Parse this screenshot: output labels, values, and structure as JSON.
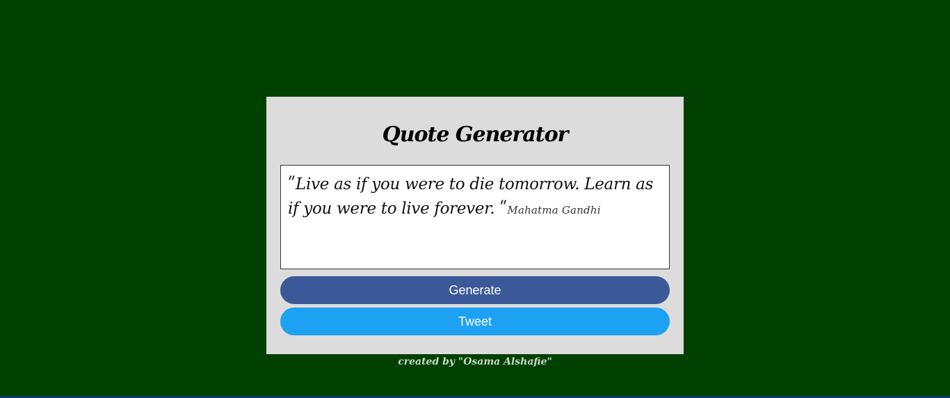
{
  "app": {
    "title": "Quote Generator"
  },
  "quote": {
    "open_mark": "ʺ",
    "text": "Live as if you were to die tomorrow. Learn as if you were to live forever. ",
    "close_mark": "ʺ",
    "author": "Mahatma Gandhi"
  },
  "buttons": {
    "generate_label": "Generate",
    "tweet_label": "Tweet"
  },
  "footer": {
    "credit": "created by \"Osama Alshafie\""
  },
  "colors": {
    "background": "#004000",
    "card": "#dcdcdc",
    "generate_button": "#3b5998",
    "tweet_button": "#1da1f2"
  }
}
